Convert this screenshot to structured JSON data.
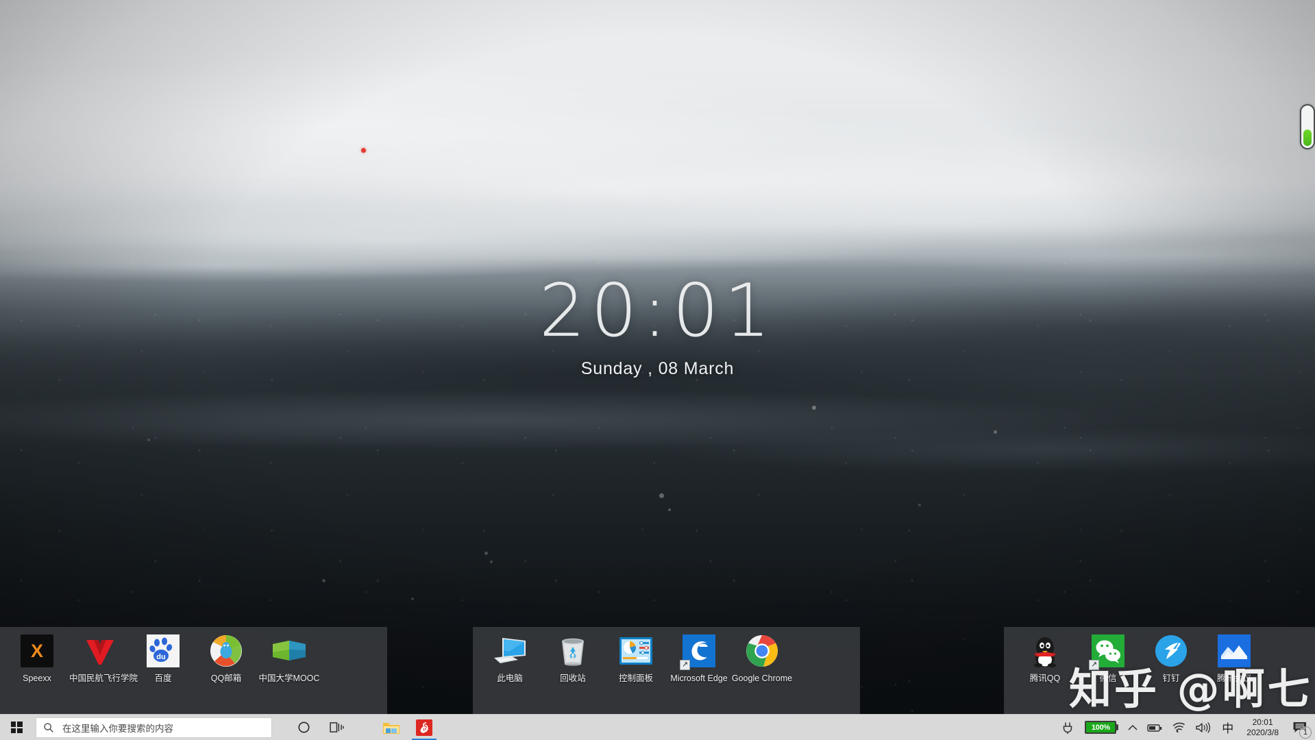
{
  "clock_widget": {
    "time": "20:01",
    "date": "Sunday , 08 March"
  },
  "watermark": {
    "text": "知乎 @啊七"
  },
  "edge_gauge": {
    "name": "battery-gauge",
    "fill_color": "#5ecb22",
    "fill_percent": 38
  },
  "desktop": {
    "groups": [
      {
        "name": "fence-left",
        "icons": [
          {
            "label": "Speexx",
            "icon": "speexx-icon",
            "shortcut": false
          },
          {
            "label": "中国民航飞行学院",
            "icon": "cafuc-icon",
            "shortcut": false
          },
          {
            "label": "百度",
            "icon": "baidu-icon",
            "shortcut": false
          },
          {
            "label": "QQ邮箱",
            "icon": "qqmail-icon",
            "shortcut": false
          },
          {
            "label": "中国大学MOOC",
            "icon": "icourse-icon",
            "shortcut": false
          }
        ]
      },
      {
        "name": "fence-middle",
        "icons": [
          {
            "label": "此电脑",
            "icon": "this-pc-icon",
            "shortcut": false
          },
          {
            "label": "回收站",
            "icon": "recycle-bin-icon",
            "shortcut": false
          },
          {
            "label": "控制面板",
            "icon": "control-panel-icon",
            "shortcut": false
          },
          {
            "label": "Microsoft Edge",
            "icon": "edge-icon",
            "shortcut": true
          },
          {
            "label": "Google Chrome",
            "icon": "chrome-icon",
            "shortcut": false
          }
        ]
      },
      {
        "name": "fence-right",
        "icons": [
          {
            "label": "腾讯QQ",
            "icon": "qq-icon",
            "shortcut": false
          },
          {
            "label": "微信",
            "icon": "wechat-icon",
            "shortcut": true
          },
          {
            "label": "钉钉",
            "icon": "dingtalk-icon",
            "shortcut": false
          },
          {
            "label": "腾讯会议",
            "icon": "tencent-meeting-icon",
            "shortcut": false
          }
        ]
      }
    ]
  },
  "taskbar": {
    "start_label": "开始",
    "search": {
      "placeholder": "在这里输入你要搜索的内容",
      "value": ""
    },
    "buttons": [
      {
        "name": "cortana-button",
        "icon": "circle-icon"
      },
      {
        "name": "task-view-button",
        "icon": "task-view-icon"
      }
    ],
    "apps": [
      {
        "name": "file-explorer",
        "icon": "folder-icon",
        "active": false
      },
      {
        "name": "netease-music",
        "icon": "netease-icon",
        "active": true
      }
    ],
    "tray": {
      "battery_percent": "100%",
      "icons": [
        {
          "name": "power-plug-icon"
        },
        {
          "name": "chevron-up-icon"
        },
        {
          "name": "battery-icon"
        },
        {
          "name": "wifi-icon"
        },
        {
          "name": "volume-icon"
        }
      ],
      "ime": "中",
      "time": "20:01",
      "date": "2020/3/8",
      "notification_count": "1"
    }
  },
  "colors": {
    "taskbar_bg": "#d9d9d9",
    "fence_bg": "rgba(56,58,61,0.88)",
    "accent_blue": "#2a7fd4",
    "battery_green": "#1aa81a"
  }
}
